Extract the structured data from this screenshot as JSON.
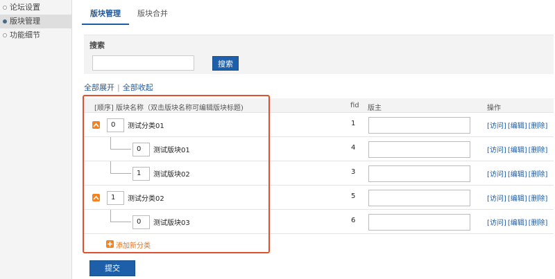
{
  "sidebar": {
    "items": [
      {
        "label": "论坛设置",
        "active": false
      },
      {
        "label": "版块管理",
        "active": true
      },
      {
        "label": "功能细节",
        "active": false
      }
    ]
  },
  "tabs": [
    {
      "label": "版块管理",
      "active": true
    },
    {
      "label": "版块合并",
      "active": false
    }
  ],
  "search": {
    "title": "搜索",
    "value": "",
    "placeholder": "",
    "button_label": "搜索"
  },
  "toggles": {
    "expand_all": "全部展开",
    "separator": "|",
    "collapse_all": "全部收起"
  },
  "table": {
    "headers": {
      "order_name": "[顺序] 版块名称（双击版块名称可编辑版块标题)",
      "fid": "fid",
      "moderator": "版主",
      "actions": "操作"
    },
    "rows": [
      {
        "kind": "category",
        "order": "0",
        "name": "测试分类01",
        "fid": "1",
        "moderator": "",
        "actions": [
          "[访问]",
          "[编辑]",
          "[删除]"
        ]
      },
      {
        "kind": "forum",
        "order": "0",
        "name": "测试版块01",
        "fid": "4",
        "moderator": "",
        "actions": [
          "[访问]",
          "[编辑]",
          "[删除]"
        ]
      },
      {
        "kind": "forum-last",
        "order": "1",
        "name": "测试版块02",
        "fid": "3",
        "moderator": "",
        "actions": [
          "[访问]",
          "[编辑]",
          "[删除]"
        ]
      },
      {
        "kind": "category",
        "order": "1",
        "name": "测试分类02",
        "fid": "5",
        "moderator": "",
        "actions": [
          "[访问]",
          "[编辑]",
          "[删除]"
        ]
      },
      {
        "kind": "forum-last",
        "order": "0",
        "name": "测试版块03",
        "fid": "6",
        "moderator": "",
        "actions": [
          "[访问]",
          "[编辑]",
          "[删除]"
        ]
      }
    ]
  },
  "add_category_label": "添加新分类",
  "submit_label": "提交",
  "colors": {
    "accent": "#1d5fa9",
    "link": "#1e5aa0",
    "orange": "#f58220",
    "highlight_border": "#e0502f"
  }
}
